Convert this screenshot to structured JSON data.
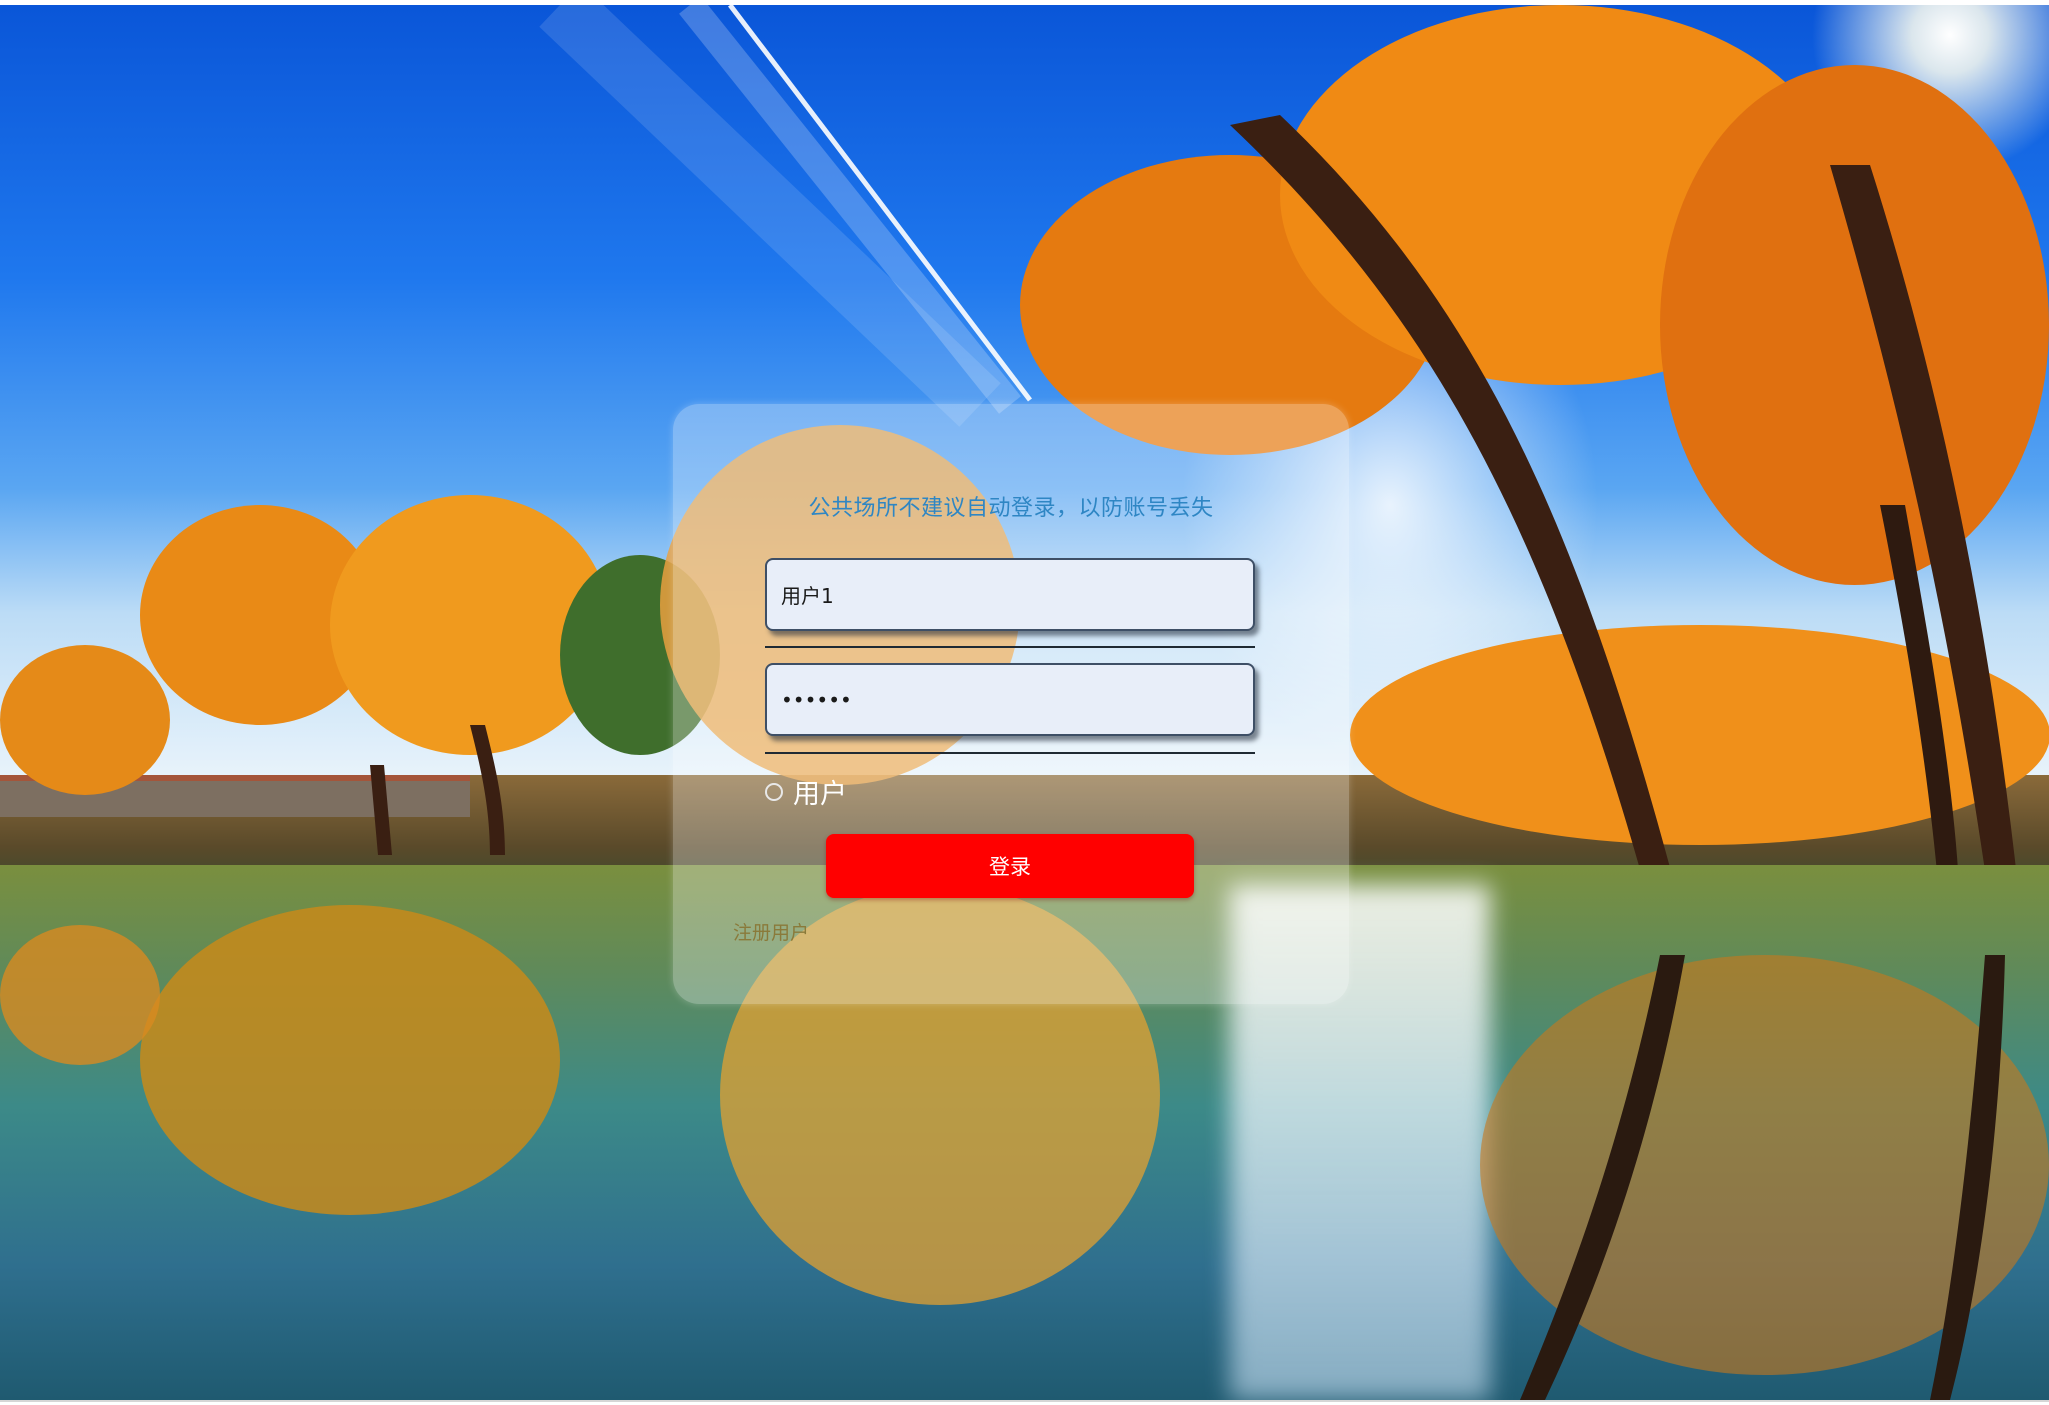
{
  "background": {
    "icon": "autumn-lake-landscape-image"
  },
  "login": {
    "notice": "公共场所不建议自动登录，以防账号丢失",
    "username_value": "用户1",
    "password_value": "••••••",
    "role_label": "用户",
    "login_button": "登录",
    "register_link": "注册用户"
  },
  "colors": {
    "accent_button": "#ff0000",
    "notice_text": "#2e86c4",
    "input_bg": "#e8eef9"
  }
}
